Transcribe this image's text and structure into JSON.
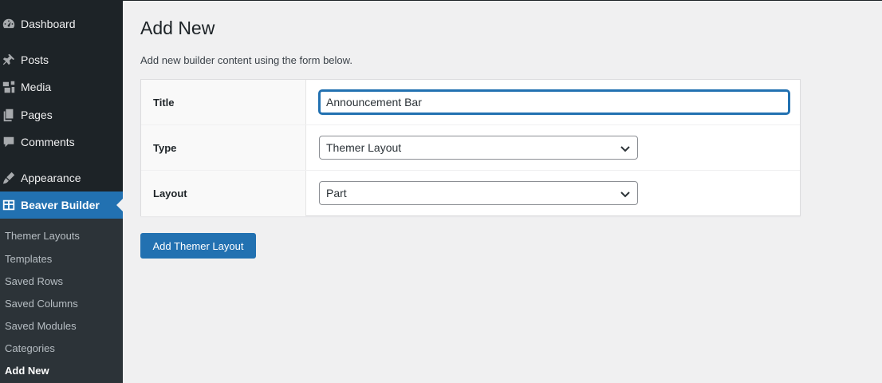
{
  "sidebar": {
    "items": [
      {
        "label": "Dashboard",
        "icon": "dashboard-icon"
      },
      {
        "label": "Posts",
        "icon": "pin-icon"
      },
      {
        "label": "Media",
        "icon": "media-icon"
      },
      {
        "label": "Pages",
        "icon": "pages-icon"
      },
      {
        "label": "Comments",
        "icon": "comment-icon"
      },
      {
        "label": "Appearance",
        "icon": "brush-icon"
      },
      {
        "label": "Beaver Builder",
        "icon": "grid-icon"
      }
    ],
    "submenu": [
      {
        "label": "Themer Layouts"
      },
      {
        "label": "Templates"
      },
      {
        "label": "Saved Rows"
      },
      {
        "label": "Saved Columns"
      },
      {
        "label": "Saved Modules"
      },
      {
        "label": "Categories"
      },
      {
        "label": "Add New"
      }
    ]
  },
  "main": {
    "title": "Add New",
    "intro": "Add new builder content using the form below.",
    "form": {
      "title_label": "Title",
      "title_value": "Announcement Bar",
      "type_label": "Type",
      "type_value": "Themer Layout",
      "layout_label": "Layout",
      "layout_value": "Part"
    },
    "submit_label": "Add Themer Layout"
  },
  "colors": {
    "sidebar_bg": "#1d2327",
    "accent": "#2271b1",
    "page_bg": "#f0f0f1"
  }
}
